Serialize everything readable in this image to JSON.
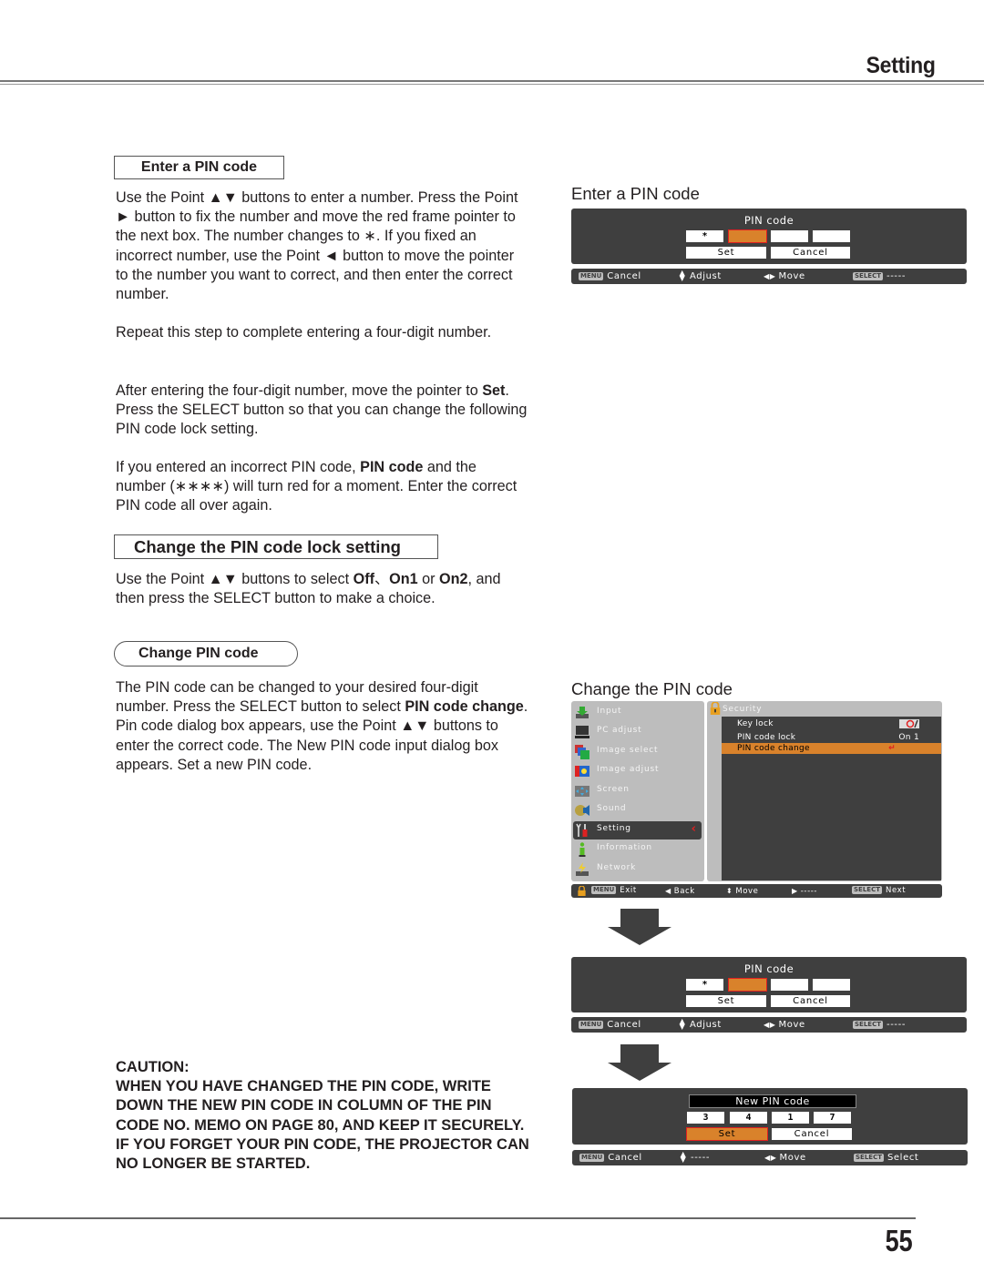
{
  "header": {
    "title": "Setting"
  },
  "left": {
    "enter_pin_heading": "Enter a PIN code",
    "enter_pin_para1": "Use the Point ▲▼ buttons to enter a number. Press the Point ► button to fix the number and move the red frame pointer to the next box. The number changes to ∗. If you fixed an incorrect number, use the Point ◄ button to move the pointer to the number you want to correct, and then enter the correct number.",
    "enter_pin_para2": "Repeat this step to complete entering a four-digit number.",
    "enter_pin_para3": {
      "pre": "After entering the four-digit number, move the pointer to ",
      "bold": "Set",
      "post": ". Press the SELECT button so that you can change the following PIN code lock setting."
    },
    "enter_pin_para4": {
      "pre": "If you entered an incorrect PIN code, ",
      "bold": "PIN code",
      "post": " and the number (∗∗∗∗) will turn red for a moment. Enter the correct PIN code all over again."
    },
    "lock_heading": "Change the PIN code lock setting",
    "lock_para": {
      "pre": "Use the Point ▲▼ buttons to select ",
      "b1": "Off",
      "sep1": "、",
      "b2": "On1",
      "sep2": " or ",
      "b3": "On2",
      "post": ", and then press the SELECT button to make a choice."
    },
    "change_heading": "Change PIN code",
    "change_para": {
      "pre": "The PIN code can be changed to your desired four-digit number. Press the SELECT button to select ",
      "bold": "PIN code change",
      "post": ". Pin code dialog box appears, use the Point ▲▼ buttons to enter the correct code. The New PIN code input dialog box appears. Set a new PIN code."
    },
    "caution_title": "CAUTION:",
    "caution_text": "WHEN YOU HAVE CHANGED THE PIN CODE, WRITE DOWN THE NEW PIN CODE IN COLUMN OF THE PIN CODE NO. MEMO ON PAGE 80, AND KEEP IT SECURELY. IF YOU FORGET YOUR PIN CODE, THE PROJECTOR CAN NO LONGER BE STARTED."
  },
  "right": {
    "enter_title": "Enter a PIN code",
    "change_title": "Change the PIN code",
    "pin_dialog": {
      "title": "PIN code",
      "cells": [
        "*",
        "",
        "",
        ""
      ],
      "active_cell": 1,
      "set_label": "Set",
      "cancel_label": "Cancel"
    },
    "pin_bar": {
      "menu_key": "MENU",
      "cancel": "Cancel",
      "adjust": "Adjust",
      "move": "Move",
      "select_key": "SELECT",
      "select_action": "-----"
    },
    "menu": {
      "items": [
        {
          "label": "Input",
          "icon": "input-icon"
        },
        {
          "label": "PC adjust",
          "icon": "pc-adjust-icon"
        },
        {
          "label": "Image select",
          "icon": "image-select-icon"
        },
        {
          "label": "Image adjust",
          "icon": "image-adjust-icon"
        },
        {
          "label": "Screen",
          "icon": "screen-icon"
        },
        {
          "label": "Sound",
          "icon": "sound-icon"
        },
        {
          "label": "Setting",
          "icon": "setting-icon"
        },
        {
          "label": "Information",
          "icon": "information-icon"
        },
        {
          "label": "Network",
          "icon": "network-icon"
        }
      ],
      "selected": "Setting",
      "submenu_title": "Security",
      "sub_items": [
        {
          "label": "Key lock",
          "value": ""
        },
        {
          "label": "PIN code lock",
          "value": "On 1"
        },
        {
          "label": "PIN code change",
          "value": "↵"
        }
      ],
      "bar": {
        "menu_key": "MENU",
        "exit": "Exit",
        "back": "Back",
        "move": "Move",
        "right": "-----",
        "select_key": "SELECT",
        "next": "Next"
      }
    },
    "new_pin_dialog": {
      "title": "New PIN code",
      "cells": [
        "3",
        "4",
        "1",
        "7"
      ],
      "set_label": "Set",
      "cancel_label": "Cancel"
    },
    "new_pin_bar": {
      "menu_key": "MENU",
      "cancel": "Cancel",
      "adjust": "-----",
      "move": "Move",
      "select_key": "SELECT",
      "select_action": "Select"
    }
  },
  "footer": {
    "page_number": "55"
  },
  "colors": {
    "osd_bg": "#3f3f3f",
    "highlight": "#d9822b",
    "frame_red": "#e02020",
    "menu_grey": "#bdbdbd"
  }
}
